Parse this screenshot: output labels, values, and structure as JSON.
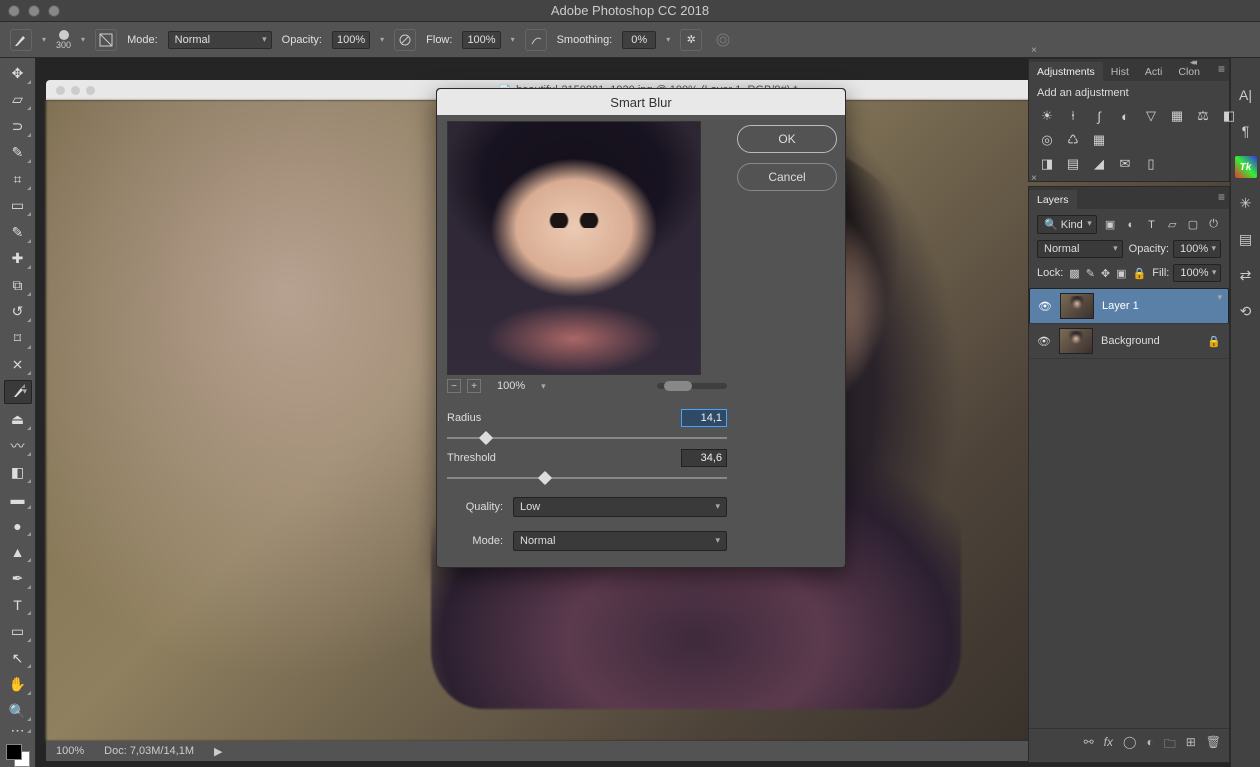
{
  "app": {
    "title": "Adobe Photoshop CC 2018"
  },
  "options_bar": {
    "brush_size": "300",
    "mode_label": "Mode:",
    "mode_value": "Normal",
    "opacity_label": "Opacity:",
    "opacity_value": "100%",
    "flow_label": "Flow:",
    "flow_value": "100%",
    "smoothing_label": "Smoothing:",
    "smoothing_value": "0%"
  },
  "document": {
    "tab_title": "beautiful-2150881_1920.jpg @ 100% (Layer 1, RGB/8#) *",
    "zoom": "100%",
    "doc_info": "Doc: 7,03M/14,1M"
  },
  "dialog": {
    "title": "Smart Blur",
    "ok": "OK",
    "cancel": "Cancel",
    "zoom_pct": "100%",
    "radius_label": "Radius",
    "radius_value": "14,1",
    "threshold_label": "Threshold",
    "threshold_value": "34,6",
    "quality_label": "Quality:",
    "quality_value": "Low",
    "mode_label": "Mode:",
    "mode_value": "Normal",
    "radius_pos_pct": 14,
    "threshold_pos_pct": 35
  },
  "adjustments_panel": {
    "tabs": [
      "Adjustments",
      "Hist",
      "Acti",
      "Clon"
    ],
    "heading": "Add an adjustment"
  },
  "layers_panel": {
    "tab": "Layers",
    "kind_label": "Kind",
    "blend_mode": "Normal",
    "opacity_label": "Opacity:",
    "opacity_value": "100%",
    "lock_label": "Lock:",
    "fill_label": "Fill:",
    "fill_value": "100%",
    "layers": [
      {
        "name": "Layer 1",
        "visible": true,
        "locked": false,
        "selected": true
      },
      {
        "name": "Background",
        "visible": true,
        "locked": true,
        "selected": false
      }
    ]
  },
  "right_strip_icons": [
    "A|",
    "¶",
    "Tk",
    "✳",
    "▤",
    "⌁",
    "⇄"
  ]
}
